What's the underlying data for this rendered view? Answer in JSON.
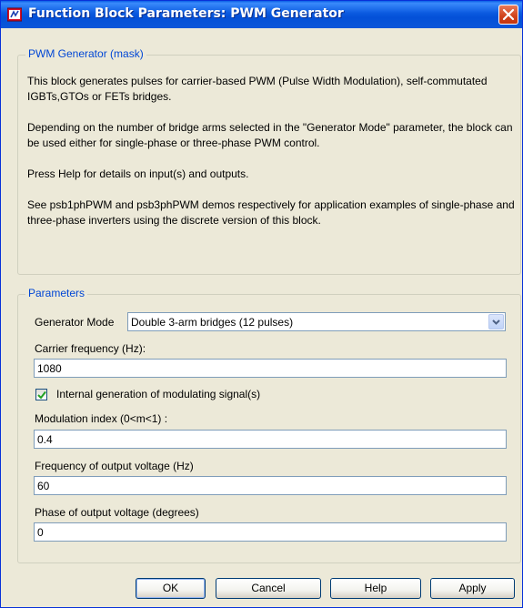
{
  "window": {
    "title": "Function Block Parameters: PWM Generator"
  },
  "mask_group": {
    "legend": "PWM Generator (mask)",
    "paragraphs": [
      "This block generates pulses for carrier-based PWM (Pulse Width Modulation), self-commutated IGBTs,GTOs or FETs bridges.",
      "Depending on the number of bridge arms selected in the \"Generator Mode\" parameter, the block can be used either for single-phase or three-phase PWM control.",
      "Press Help for details on input(s) and outputs.",
      "See psb1phPWM and psb3phPWM demos respectively  for application examples of single-phase and three-phase inverters using the discrete version of this block."
    ]
  },
  "params_group": {
    "legend": "Parameters",
    "generator_mode": {
      "label": "Generator Mode",
      "value": "Double 3-arm  bridges (12 pulses)"
    },
    "carrier_frequency": {
      "label": "Carrier frequency (Hz):",
      "value": "1080"
    },
    "internal_generation": {
      "label": "Internal generation of modulating signal(s)",
      "checked": true
    },
    "modulation_index": {
      "label": "Modulation index  (0<m<1) :",
      "value": "0.4"
    },
    "output_frequency": {
      "label": "Frequency of output voltage (Hz)",
      "value": "60"
    },
    "output_phase": {
      "label": "Phase of output voltage (degrees)",
      "value": "0"
    }
  },
  "buttons": {
    "ok": "OK",
    "cancel": "Cancel",
    "help": "Help",
    "apply": "Apply"
  },
  "icons": {
    "title_icon": "simulink-block-icon",
    "close_icon": "close-icon",
    "dropdown_icon": "chevron-down-icon",
    "check_icon": "checkmark-icon"
  },
  "colors": {
    "titlebar": "#0a5fe5",
    "dialog_bg": "#ece9d8",
    "legend_text": "#0046d5",
    "close_button": "#d0421b",
    "check_mark": "#21a121"
  }
}
